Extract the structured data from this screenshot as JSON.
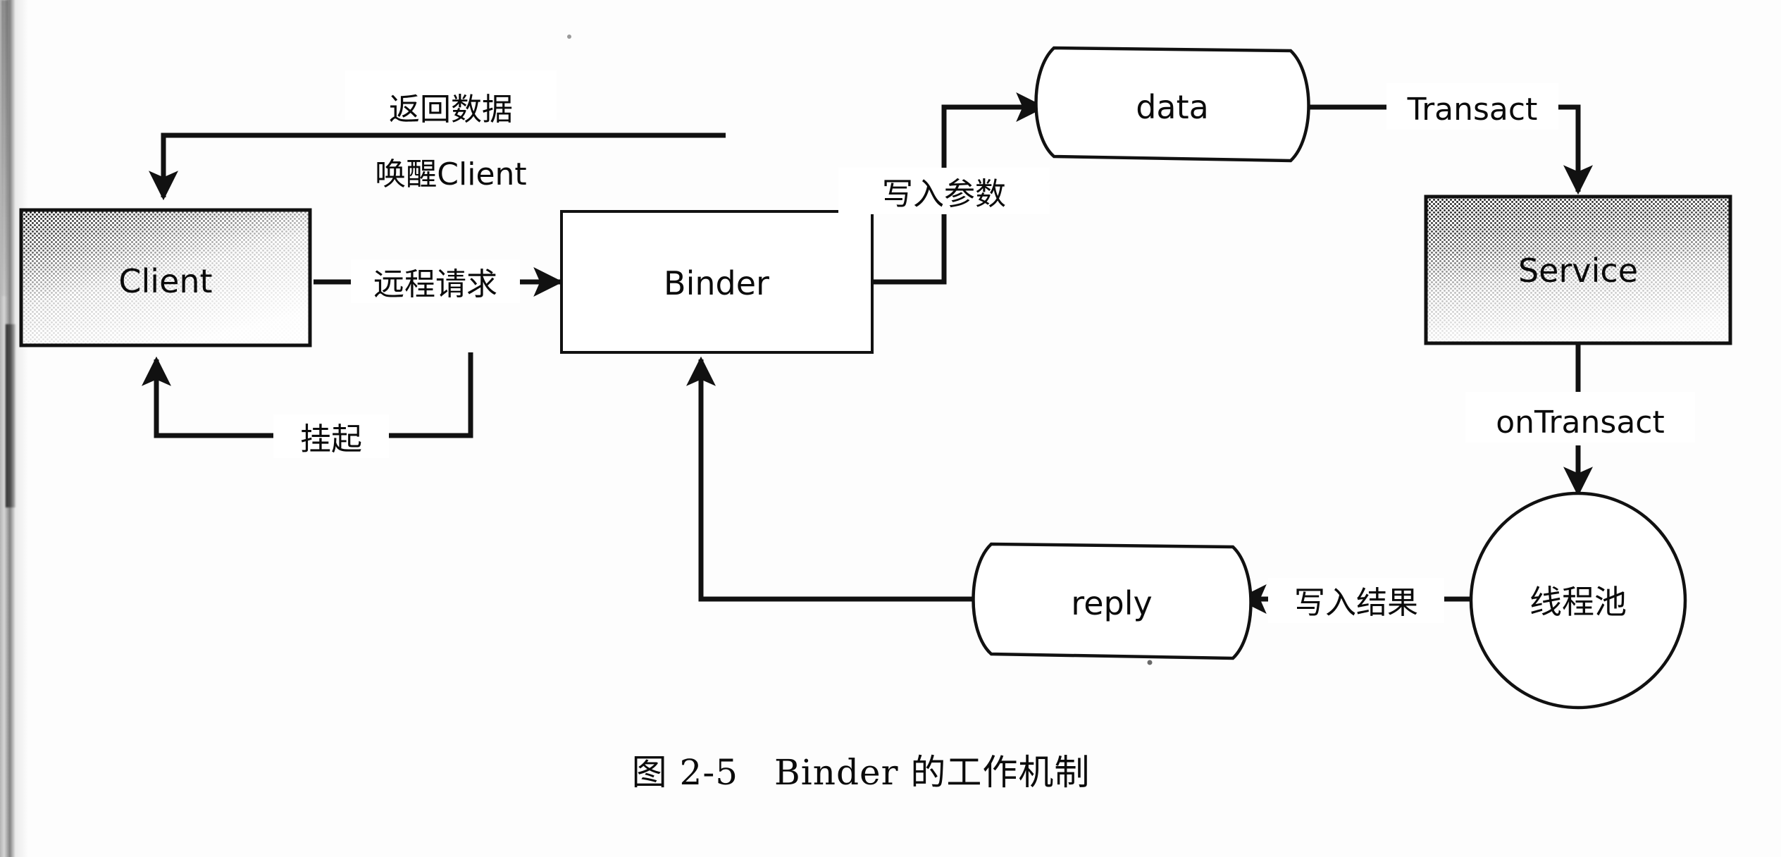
{
  "figure": {
    "caption": "图 2-5　Binder 的工作机制",
    "caption_number": "图 2-5",
    "caption_title": "Binder 的工作机制"
  },
  "colors": {
    "background": "#ffffff",
    "stroke": "#111111",
    "shaded_fill_dark": "#3a3a3a",
    "shaded_fill_light": "#f2f2f2"
  },
  "nodes": [
    {
      "id": "client",
      "label": "Client",
      "shape": "shaded-rect"
    },
    {
      "id": "binder",
      "label": "Binder",
      "shape": "rect"
    },
    {
      "id": "data",
      "label": "data",
      "shape": "tape"
    },
    {
      "id": "service",
      "label": "Service",
      "shape": "shaded-rect"
    },
    {
      "id": "threadpool",
      "label": "线程池",
      "shape": "circle"
    },
    {
      "id": "reply",
      "label": "reply",
      "shape": "tape"
    }
  ],
  "edges": [
    {
      "id": "e-return-data",
      "label": "返回数据",
      "from": "binder",
      "to": "client",
      "direction": "left-down"
    },
    {
      "id": "e-wake-client",
      "label": "唤醒Client",
      "from": "binder",
      "to": "client",
      "direction": "left-down"
    },
    {
      "id": "e-remote-request",
      "label": "远程请求",
      "from": "client",
      "to": "binder",
      "direction": "right"
    },
    {
      "id": "e-suspend",
      "label": "挂起",
      "from": "binder",
      "to": "client",
      "direction": "left-up"
    },
    {
      "id": "e-write-params",
      "label": "写入参数",
      "from": "binder",
      "to": "data",
      "direction": "up-right"
    },
    {
      "id": "e-transact",
      "label": "Transact",
      "from": "data",
      "to": "service",
      "direction": "right-down"
    },
    {
      "id": "e-ontransact",
      "label": "onTransact",
      "from": "service",
      "to": "threadpool",
      "direction": "down"
    },
    {
      "id": "e-write-result",
      "label": "写入结果",
      "from": "threadpool",
      "to": "reply",
      "direction": "left"
    },
    {
      "id": "e-reply-binder",
      "label": "",
      "from": "reply",
      "to": "binder",
      "direction": "left-up"
    }
  ],
  "labels": {
    "return_data": "返回数据",
    "wake_client": "唤醒Client",
    "remote_request": "远程请求",
    "suspend": "挂起",
    "write_params": "写入参数",
    "transact": "Transact",
    "on_transact": "onTransact",
    "write_result": "写入结果"
  },
  "node_labels": {
    "client": "Client",
    "binder": "Binder",
    "data": "data",
    "service": "Service",
    "threadpool": "线程池",
    "reply": "reply"
  }
}
